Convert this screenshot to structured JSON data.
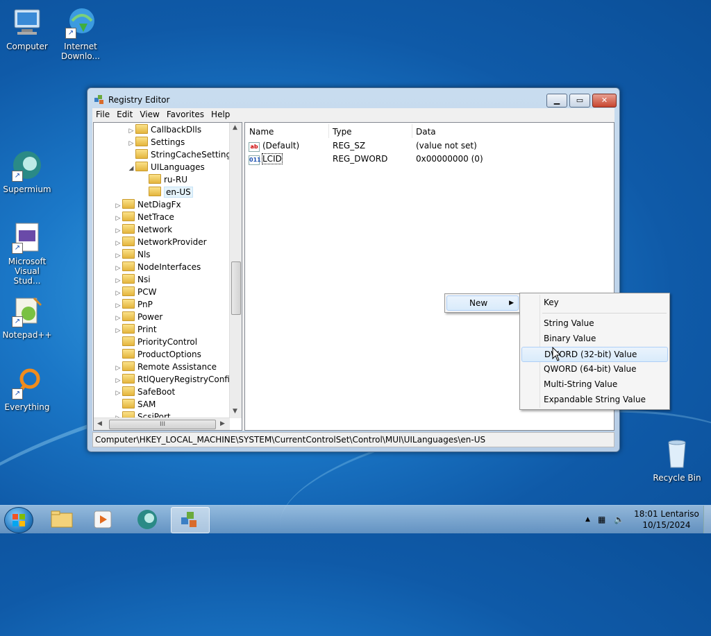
{
  "desktop": {
    "icons": [
      {
        "label": "Computer",
        "icon": "computer-icon"
      },
      {
        "label": "Internet Downlo...",
        "icon": "internet-download-icon"
      },
      {
        "label": "Supermium",
        "icon": "supermium-icon"
      },
      {
        "label": "Microsoft Visual Stud...",
        "icon": "visual-studio-icon"
      },
      {
        "label": "Notepad++",
        "icon": "notepad-plus-plus-icon"
      },
      {
        "label": "Everything",
        "icon": "everything-icon"
      },
      {
        "label": "Recycle Bin",
        "icon": "recycle-bin-icon"
      }
    ]
  },
  "window": {
    "title": "Registry Editor",
    "menu": [
      "File",
      "Edit",
      "View",
      "Favorites",
      "Help"
    ],
    "tree": [
      {
        "label": "CallbackDlls",
        "toggle": "▷"
      },
      {
        "label": "Settings",
        "toggle": "▷"
      },
      {
        "label": "StringCacheSettings",
        "toggle": ""
      },
      {
        "label": "UILanguages",
        "toggle": "◢"
      },
      {
        "label": "ru-RU",
        "toggle": ""
      },
      {
        "label": "en-US",
        "toggle": ""
      },
      {
        "label": "NetDiagFx",
        "toggle": "▷"
      },
      {
        "label": "NetTrace",
        "toggle": "▷"
      },
      {
        "label": "Network",
        "toggle": "▷"
      },
      {
        "label": "NetworkProvider",
        "toggle": "▷"
      },
      {
        "label": "Nls",
        "toggle": "▷"
      },
      {
        "label": "NodeInterfaces",
        "toggle": "▷"
      },
      {
        "label": "Nsi",
        "toggle": "▷"
      },
      {
        "label": "PCW",
        "toggle": "▷"
      },
      {
        "label": "PnP",
        "toggle": "▷"
      },
      {
        "label": "Power",
        "toggle": "▷"
      },
      {
        "label": "Print",
        "toggle": "▷"
      },
      {
        "label": "PriorityControl",
        "toggle": ""
      },
      {
        "label": "ProductOptions",
        "toggle": ""
      },
      {
        "label": "Remote Assistance",
        "toggle": "▷"
      },
      {
        "label": "RtlQueryRegistryConfig",
        "toggle": "▷"
      },
      {
        "label": "SafeBoot",
        "toggle": "▷"
      },
      {
        "label": "SAM",
        "toggle": ""
      },
      {
        "label": "ScsiPort",
        "toggle": "▷"
      }
    ],
    "columns": {
      "name": "Name",
      "type": "Type",
      "data": "Data"
    },
    "values": [
      {
        "name": "(Default)",
        "type": "REG_SZ",
        "data": "(value not set)",
        "icon": "ab"
      },
      {
        "name": "LCID",
        "type": "REG_DWORD",
        "data": "0x00000000 (0)",
        "icon": "011"
      }
    ],
    "status_path": "Computer\\HKEY_LOCAL_MACHINE\\SYSTEM\\CurrentControlSet\\Control\\MUI\\UILanguages\\en-US",
    "hscroll_grip": "III"
  },
  "context_menu": {
    "new_label": "New",
    "submenu": [
      "Key",
      "String Value",
      "Binary Value",
      "DWORD (32-bit) Value",
      "QWORD (64-bit) Value",
      "Multi-String Value",
      "Expandable String Value"
    ],
    "highlighted": "DWORD (32-bit) Value"
  },
  "taskbar": {
    "time": "18:01 Lentariso",
    "date": "10/15/2024"
  }
}
